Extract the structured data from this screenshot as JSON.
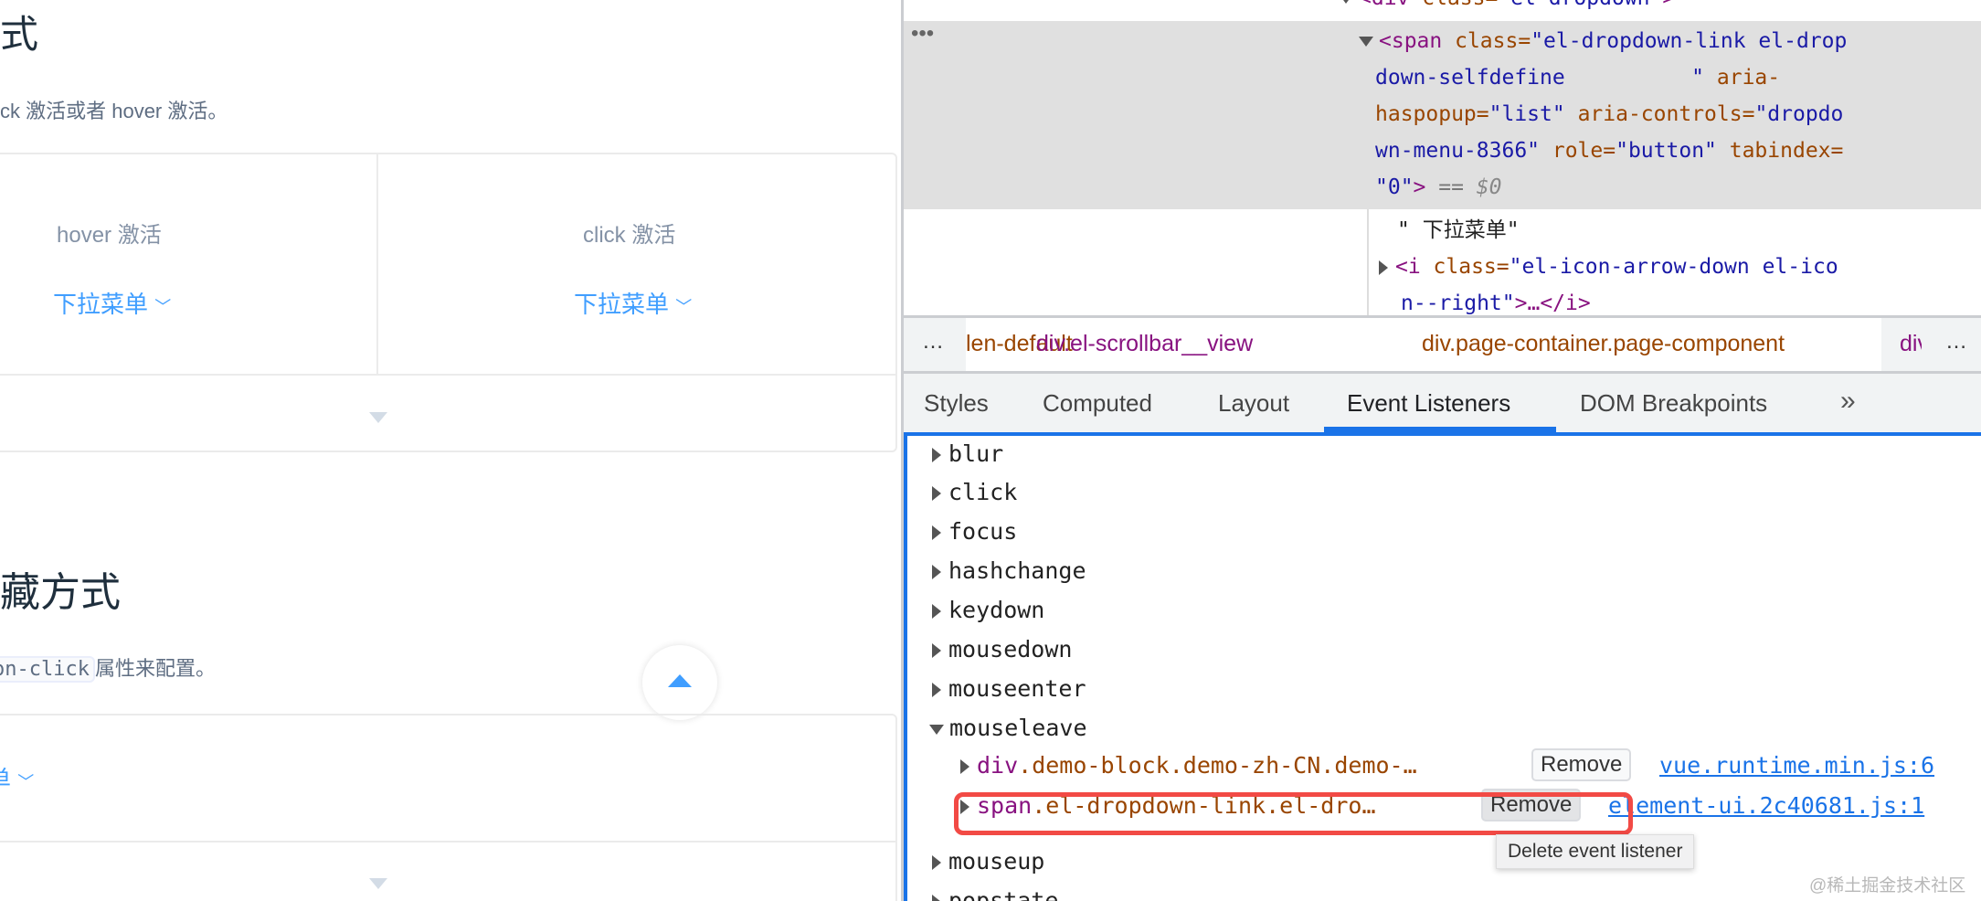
{
  "left": {
    "heading1": "式",
    "desc1": "ck 激活或者 hover 激活。",
    "demo1": {
      "col1_label": "hover 激活",
      "col2_label": "click 激活",
      "dropdown1": "下拉菜单",
      "dropdown2": "下拉菜单"
    },
    "heading2": "藏方式",
    "desc2_code": "on-click",
    "desc2_text": "属性来配置。",
    "demo2": {
      "dropdown": "单"
    },
    "colors": {
      "link": "#409eff",
      "text": "#5e6d82"
    }
  },
  "devtools": {
    "dom": {
      "line0": {
        "tag": "<div ",
        "attr": "class=",
        "val": "\"el-dropdown\"",
        "end": ">"
      },
      "selected": {
        "l1a": "<span ",
        "l1b": "class=",
        "l1c": "\"el-dropdown-link el-drop",
        "l2": "down-selfdefine          \"",
        "l2b": " aria-",
        "l3a": "haspopup=",
        "l3b": "\"list\"",
        "l3c": " aria-controls=",
        "l3d": "\"dropdo",
        "l4a": "wn-menu-8366\"",
        "l4b": " role=",
        "l4c": "\"button\"",
        "l4d": " tabindex=",
        "l5a": "\"0\"",
        "l5b": ">",
        "l5c": " == ",
        "l5d": "$0"
      },
      "text_node": "\" 下拉菜单\"",
      "child1": "<i ",
      "child1b": "class=",
      "child1c": "\"el-icon-arrow-down el-ico",
      "child2": "n--right\"",
      "child2b": ">…</i>"
    },
    "breadcrumbs": [
      "len-default",
      "div.el-scrollbar__view",
      "div.page-container.page-component",
      "div"
    ],
    "tabs": [
      "Styles",
      "Computed",
      "Layout",
      "Event Listeners",
      "DOM Breakpoints",
      "»"
    ],
    "active_tab": "Event Listeners",
    "events": [
      "blur",
      "click",
      "focus",
      "hashchange",
      "keydown",
      "mousedown",
      "mouseenter",
      "mouseleave",
      "mouseup",
      "popstate"
    ],
    "listeners": [
      {
        "node_tag": "div",
        "node_rest": ".demo-block.demo-zh-CN.demo-…",
        "remove": "Remove",
        "source": "vue.runtime.min.js:6"
      },
      {
        "node_tag": "span",
        "node_rest": ".el-dropdown-link.el-dro…",
        "remove": "Remove",
        "source": "element-ui.2c40681.js:1"
      }
    ],
    "tooltip": "Delete event listener",
    "colors": {
      "accent": "#1a73e8",
      "highlight": "#f24a45"
    }
  },
  "watermark": "@稀土掘金技术社区"
}
